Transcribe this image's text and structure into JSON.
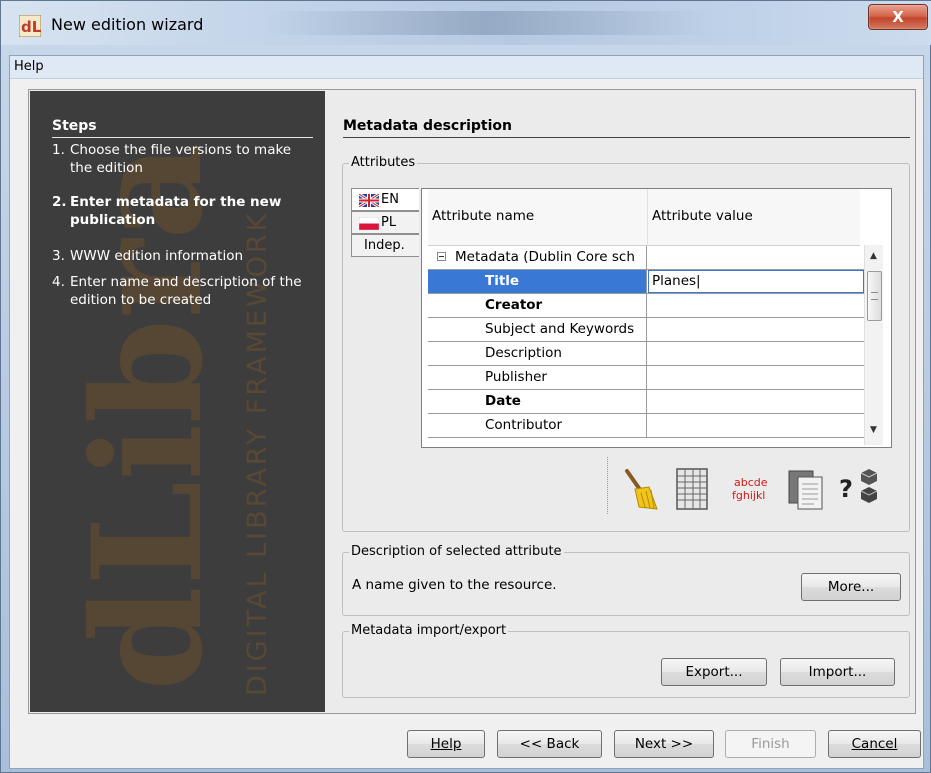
{
  "window": {
    "title": "New edition wizard",
    "close_label": "X"
  },
  "menu": {
    "help": "Help"
  },
  "steps": {
    "title": "Steps",
    "items": [
      {
        "num": "1.",
        "text": "Choose the file versions to make the edition"
      },
      {
        "num": "2.",
        "text": "Enter metadata for the new publication"
      },
      {
        "num": "3.",
        "text": "WWW edition information"
      },
      {
        "num": "4.",
        "text": "Enter name and description of the edition to be created"
      }
    ],
    "active_index": 1
  },
  "watermark": {
    "logo_text": "dLibra",
    "tagline": "DIGITAL LIBRARY FRAMEWORK"
  },
  "metadata": {
    "title": "Metadata description",
    "attributes_label": "Attributes",
    "lang_tabs": [
      "EN",
      "PL",
      "Indep."
    ],
    "selected_tab": "EN",
    "columns": [
      "Attribute name",
      "Attribute value"
    ],
    "rows": [
      {
        "name": "Metadata (Dublin Core sch",
        "value": "",
        "group": true
      },
      {
        "name": "Title",
        "value": "Planes|",
        "bold": true,
        "selected": true
      },
      {
        "name": "Creator",
        "value": "",
        "bold": true
      },
      {
        "name": "Subject and Keywords",
        "value": ""
      },
      {
        "name": "Description",
        "value": ""
      },
      {
        "name": "Publisher",
        "value": ""
      },
      {
        "name": "Date",
        "value": "",
        "bold": true
      },
      {
        "name": "Contributor",
        "value": ""
      }
    ],
    "tool_icons": [
      "broom-icon",
      "table-icon",
      "font-sample-icon",
      "documents-icon",
      "help-cubes-icon"
    ],
    "font_sample_lines": [
      "abcde",
      "fghijkl"
    ],
    "help_glyph": "?"
  },
  "description": {
    "label": "Description of selected attribute",
    "text": "A name given to the resource.",
    "more_button": "More..."
  },
  "import_export": {
    "label": "Metadata import/export",
    "export_button": "Export...",
    "import_button": "Import..."
  },
  "footer": {
    "help": "Help",
    "back": "<< Back",
    "next": "Next >>",
    "finish": "Finish",
    "cancel": "Cancel"
  },
  "colors": {
    "selection": "#3a78d6",
    "steps_bg": "#3d3d3d",
    "watermark": "#7a5a2e"
  }
}
